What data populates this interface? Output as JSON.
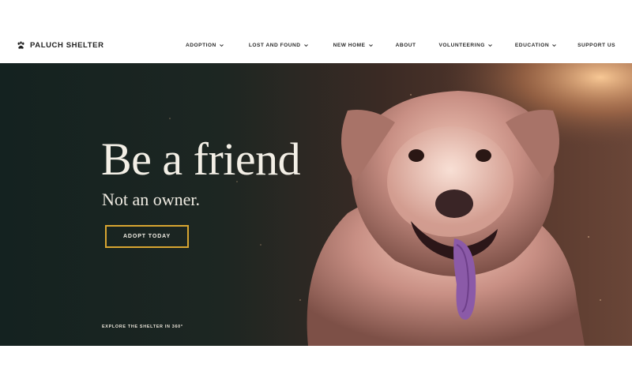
{
  "brand": {
    "name": "PALUCH SHELTER",
    "icon": "paw-icon"
  },
  "nav": {
    "items": [
      {
        "label": "ADOPTION",
        "dropdown": true
      },
      {
        "label": "LOST AND FOUND",
        "dropdown": true
      },
      {
        "label": "NEW HOME",
        "dropdown": true
      },
      {
        "label": "ABOUT",
        "dropdown": false
      },
      {
        "label": "VOLUNTEERING",
        "dropdown": true
      },
      {
        "label": "EDUCATION",
        "dropdown": true
      },
      {
        "label": "SUPPORT US",
        "dropdown": false
      }
    ]
  },
  "hero": {
    "headline": "Be a friend",
    "subheadline": "Not an owner.",
    "cta_label": "ADOPT TODAY",
    "explore_label": "EXPLORE THE SHELTER IN 360°",
    "image": "dog-photo"
  },
  "colors": {
    "accent": "#d8a531",
    "hero_dark": "#15201e",
    "hero_text": "#f3efe6"
  }
}
